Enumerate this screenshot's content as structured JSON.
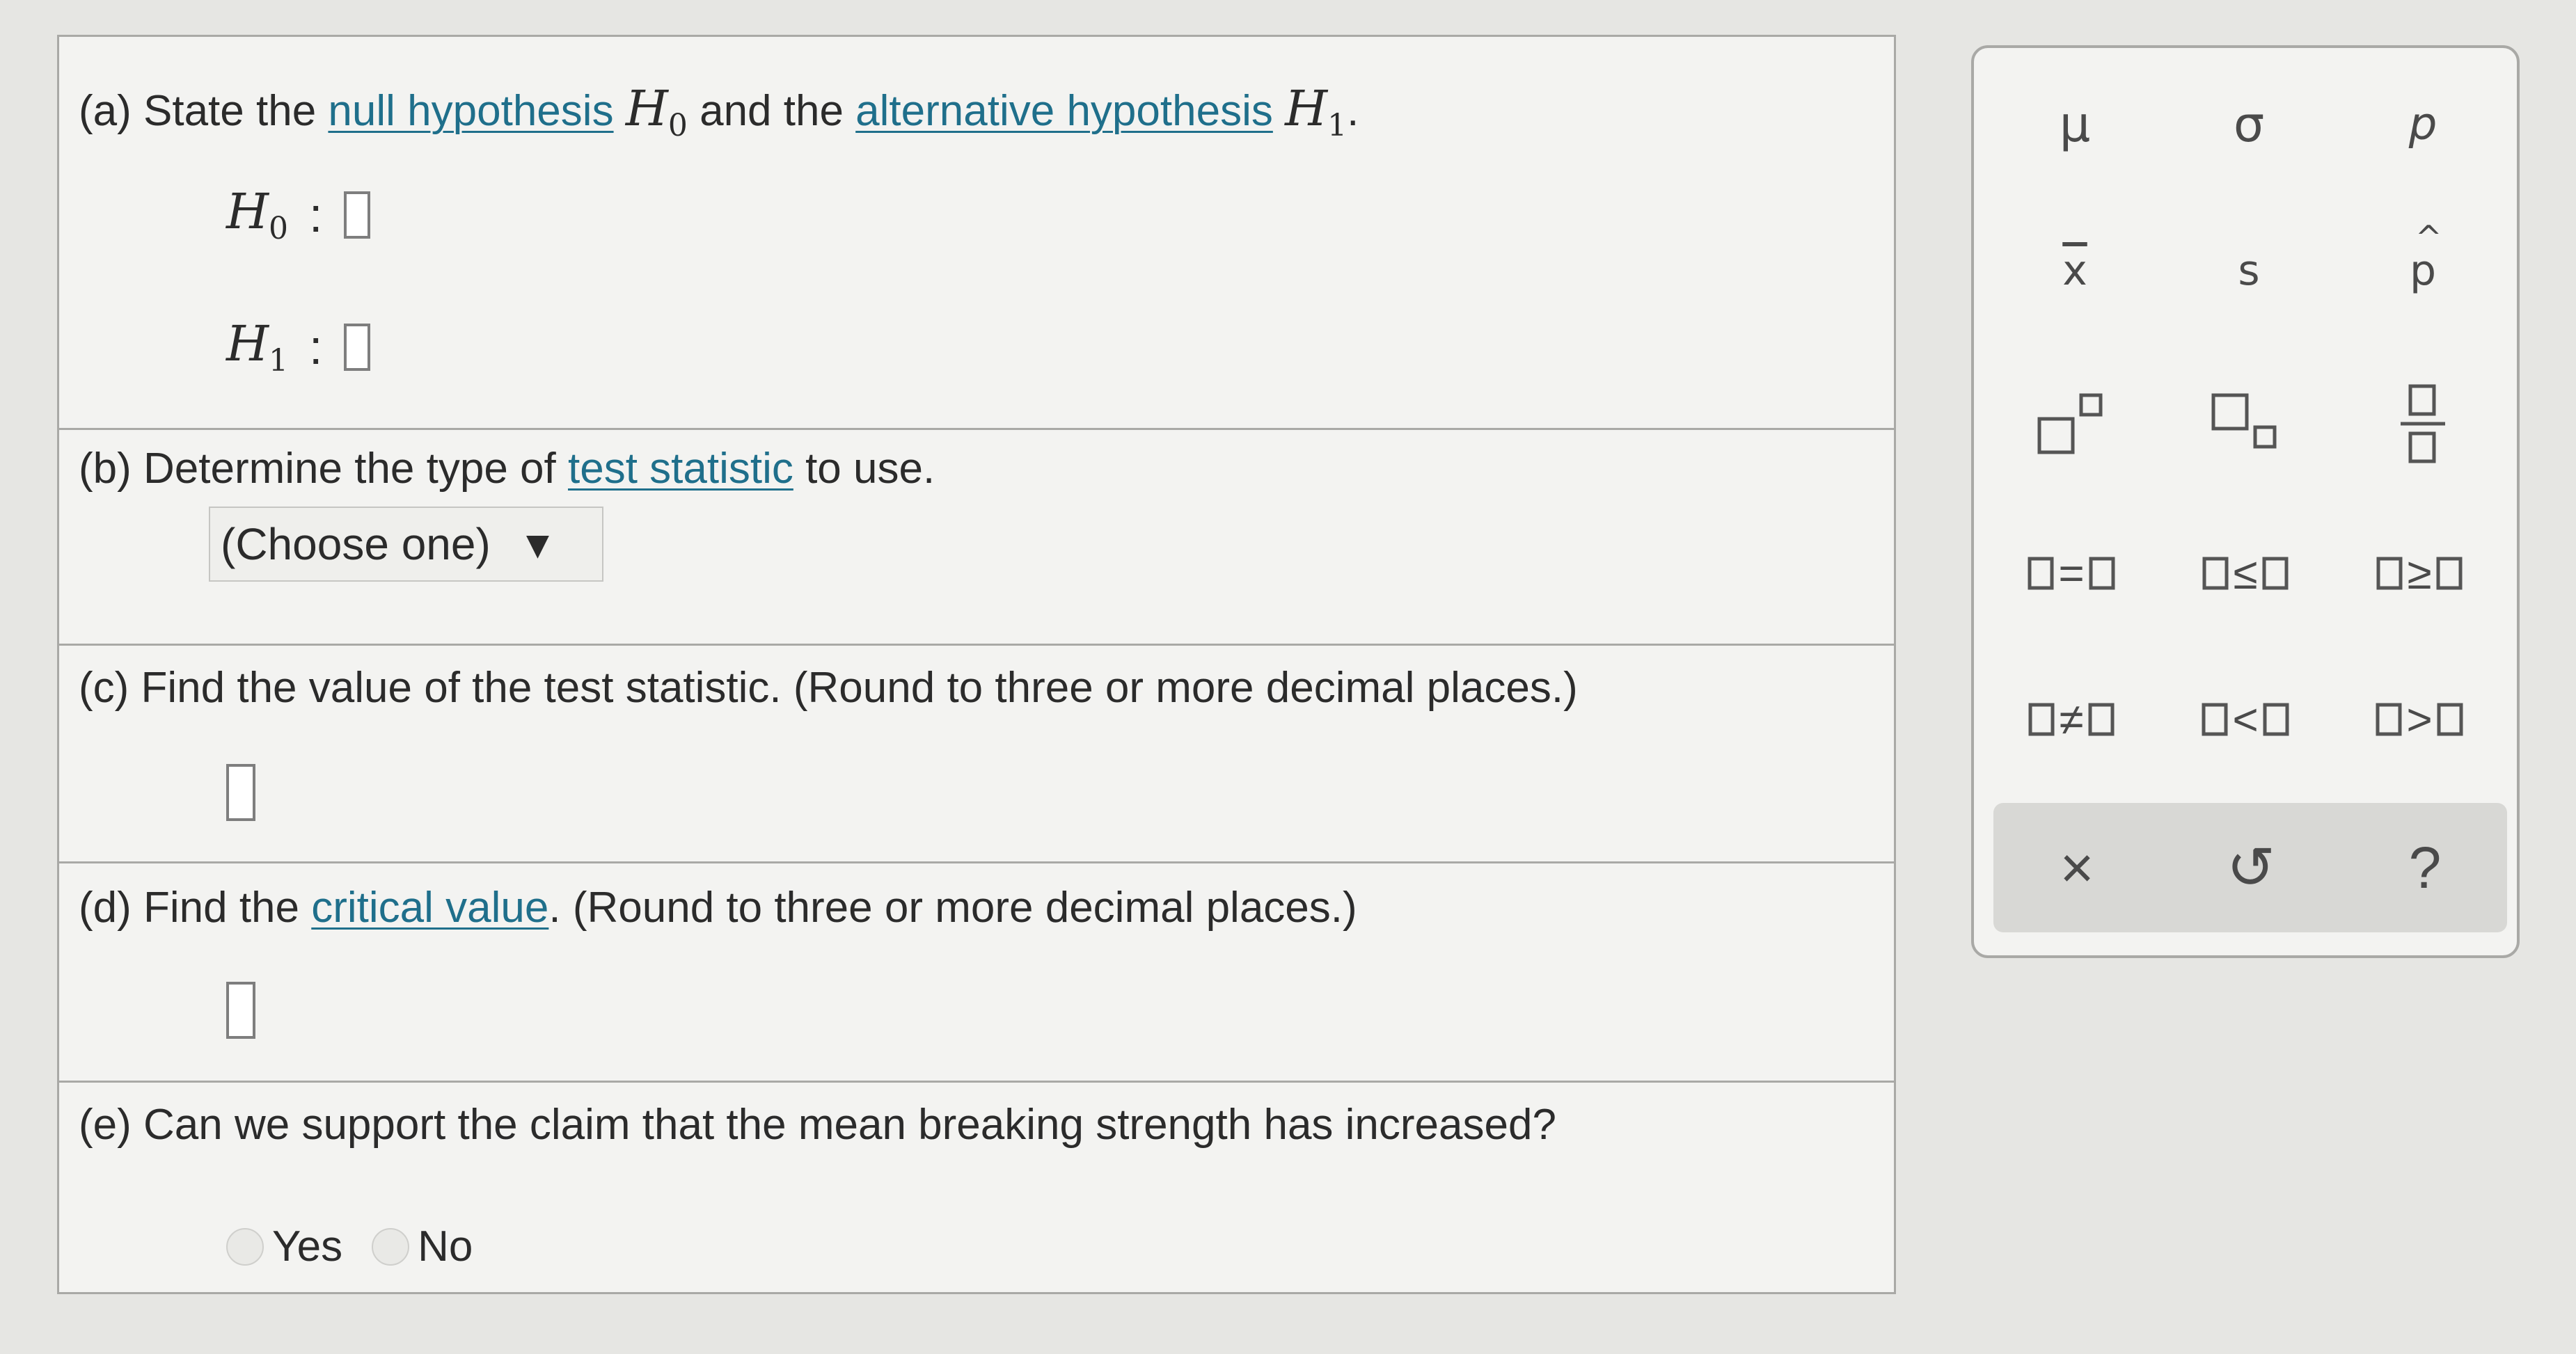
{
  "part_a": {
    "prefix": "(a)  State the ",
    "null_link": "null hypothesis",
    "h0": "H",
    "h0_sub": "0",
    "mid": " and the ",
    "alt_link": "alternative hypothesis",
    "h1": "H",
    "h1_sub": "1",
    "end": ".",
    "h0_label": "H",
    "h0_label_sub": "0",
    "h1_label": "H",
    "h1_label_sub": "1",
    "colon": ":"
  },
  "part_b": {
    "prefix": "(b)  Determine the type of ",
    "link": "test statistic",
    "suffix": " to use.",
    "select_value": "(Choose one)"
  },
  "part_c": {
    "text": "(c)  Find the value of the test statistic. (Round to three or more decimal places.)"
  },
  "part_d": {
    "prefix": "(d)  Find the ",
    "link": "critical value",
    "suffix": ". (Round to three or more decimal places.)"
  },
  "part_e": {
    "text": "(e)  Can we support the claim that the mean breaking strength has increased?",
    "yes": "Yes",
    "no": "No"
  },
  "palette": {
    "mu": "μ",
    "sigma": "σ",
    "p": "p",
    "xbar": "x",
    "s": "s",
    "phat": "p",
    "eq": "=",
    "le": "≤",
    "ge": "≥",
    "ne": "≠",
    "lt": "<",
    "gt": ">",
    "clear": "×",
    "undo": "↺",
    "help": "?"
  },
  "colors": {
    "link": "#1f6f8b",
    "border": "#a9a9a6",
    "panel": "#f3f3f1"
  }
}
